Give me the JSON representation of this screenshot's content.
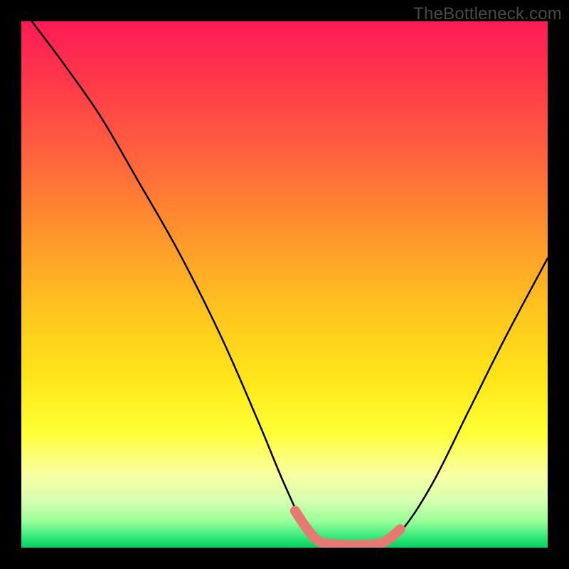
{
  "watermark": "TheBottleneck.com",
  "chart_data": {
    "type": "line",
    "title": "",
    "xlabel": "",
    "ylabel": "",
    "xlim": [
      0,
      100
    ],
    "ylim": [
      0,
      100
    ],
    "grid": false,
    "series": [
      {
        "name": "bottleneck-curve",
        "color": "#000000",
        "stroke_width": 2.5,
        "points": [
          {
            "x": 2,
            "y": 100
          },
          {
            "x": 8,
            "y": 92
          },
          {
            "x": 15,
            "y": 82
          },
          {
            "x": 22,
            "y": 70
          },
          {
            "x": 30,
            "y": 56
          },
          {
            "x": 38,
            "y": 40
          },
          {
            "x": 45,
            "y": 24
          },
          {
            "x": 50,
            "y": 12
          },
          {
            "x": 54,
            "y": 4
          },
          {
            "x": 58,
            "y": 0.8
          },
          {
            "x": 63,
            "y": 0.5
          },
          {
            "x": 68,
            "y": 0.8
          },
          {
            "x": 72,
            "y": 3
          },
          {
            "x": 78,
            "y": 12
          },
          {
            "x": 85,
            "y": 26
          },
          {
            "x": 92,
            "y": 40
          },
          {
            "x": 100,
            "y": 55
          }
        ]
      },
      {
        "name": "optimal-range-marker",
        "color": "#e67a72",
        "stroke_width": 14,
        "linecap": "round",
        "points": [
          {
            "x": 52,
            "y": 7
          },
          {
            "x": 54,
            "y": 4
          },
          {
            "x": 56,
            "y": 1.6
          },
          {
            "x": 58,
            "y": 0.8
          },
          {
            "x": 63,
            "y": 0.5
          },
          {
            "x": 68,
            "y": 0.8
          },
          {
            "x": 70,
            "y": 1.8
          },
          {
            "x": 72,
            "y": 3.5
          }
        ]
      }
    ]
  }
}
